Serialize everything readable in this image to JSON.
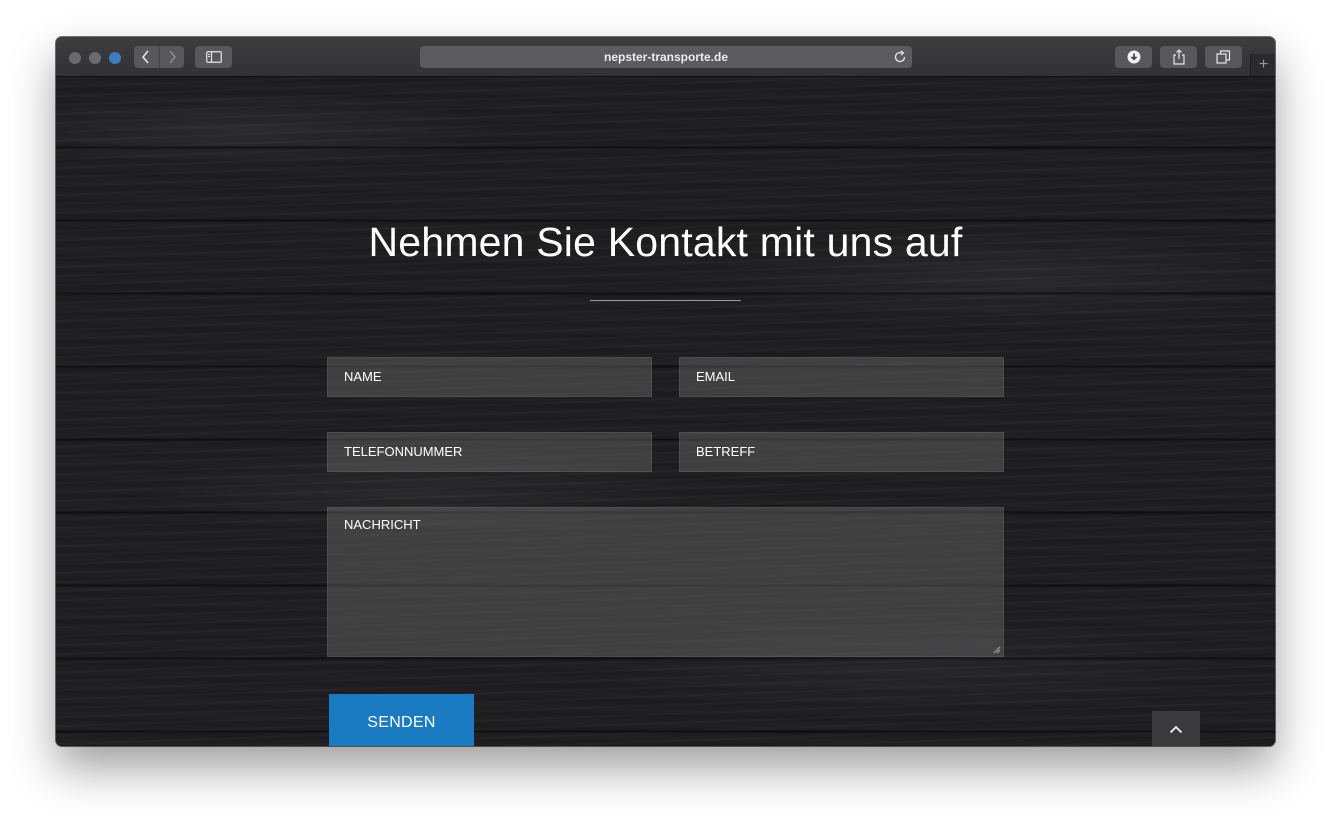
{
  "browser": {
    "url": "nepster-transporte.de"
  },
  "contact": {
    "heading": "Nehmen Sie Kontakt mit uns auf",
    "fields": {
      "name": "NAME",
      "email": "EMAIL",
      "phone": "TELEFONNUMMER",
      "subject": "BETREFF",
      "message": "NACHRICHT"
    },
    "submit_label": "SENDEN"
  },
  "icons": {
    "back": "chevron-left-icon",
    "forward": "chevron-right-icon",
    "sidebar": "sidebar-icon",
    "reload": "reload-icon",
    "download": "download-icon",
    "share": "share-icon",
    "tabs": "tabs-icon",
    "new_tab": "plus-icon",
    "scroll_top": "chevron-up-icon"
  },
  "colors": {
    "accent": "#1a7bc3",
    "background": "#1c1c1e"
  }
}
